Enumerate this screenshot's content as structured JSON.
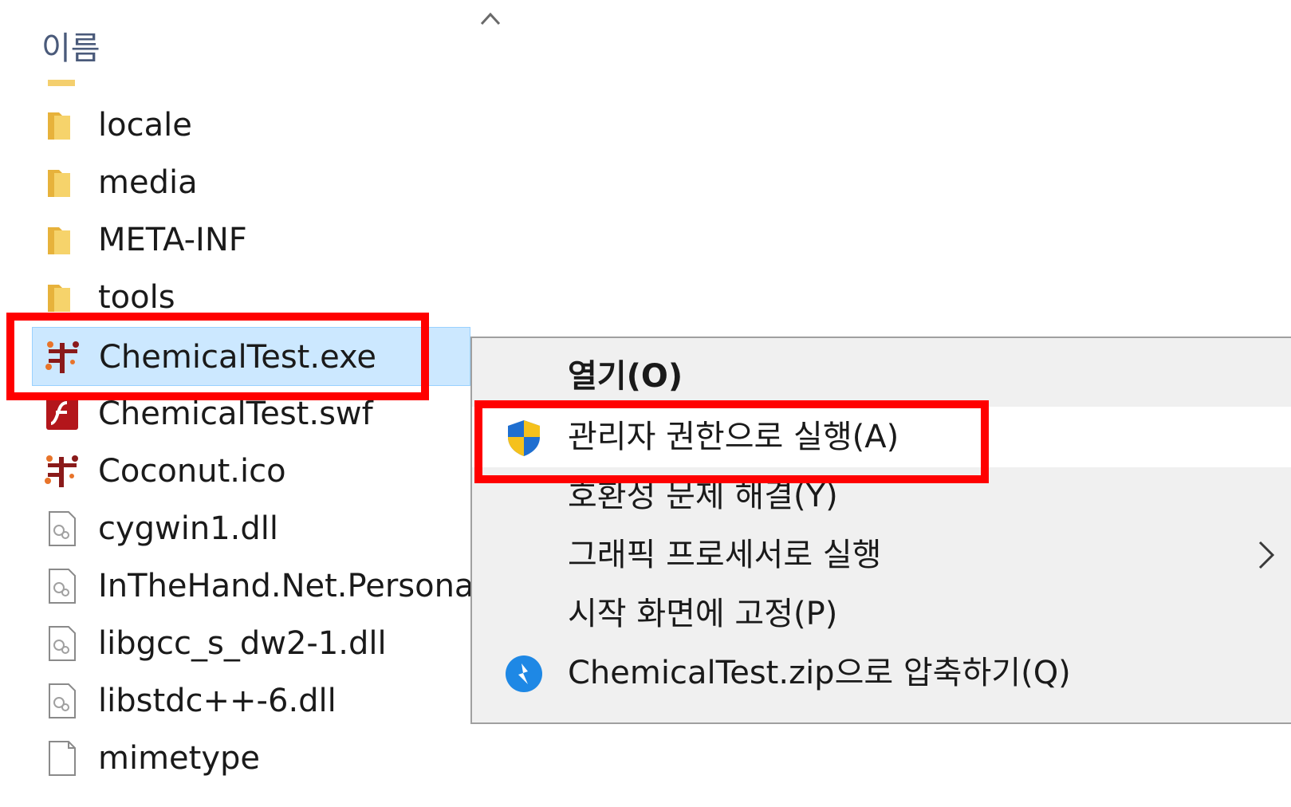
{
  "header": {
    "name_column": "이름"
  },
  "files": [
    {
      "name": "locale",
      "icon": "folder-icon"
    },
    {
      "name": "media",
      "icon": "folder-icon"
    },
    {
      "name": "META-INF",
      "icon": "folder-icon"
    },
    {
      "name": "tools",
      "icon": "folder-icon"
    },
    {
      "name": "ChemicalTest.exe",
      "icon": "exe-app-icon",
      "selected": true
    },
    {
      "name": "ChemicalTest.swf",
      "icon": "flash-file-icon"
    },
    {
      "name": "Coconut.ico",
      "icon": "ico-file-icon"
    },
    {
      "name": "cygwin1.dll",
      "icon": "dll-file-icon"
    },
    {
      "name": "InTheHand.Net.Personal.",
      "icon": "dll-file-icon"
    },
    {
      "name": "libgcc_s_dw2-1.dll",
      "icon": "dll-file-icon"
    },
    {
      "name": "libstdc++-6.dll",
      "icon": "dll-file-icon"
    },
    {
      "name": "mimetype",
      "icon": "blank-file-icon"
    }
  ],
  "context_menu": {
    "items": [
      {
        "label": "열기(O)",
        "icon": ""
      },
      {
        "label": "관리자 권한으로 실행(A)",
        "icon": "uac-shield-icon"
      },
      {
        "label": "호환성 문제 해결(Y)",
        "icon": ""
      },
      {
        "label": "그래픽 프로세서로 실행",
        "icon": "",
        "submenu": true
      },
      {
        "label": "시작 화면에 고정(P)",
        "icon": ""
      },
      {
        "label": "ChemicalTest.zip으로 압축하기(Q)",
        "icon": "bandizip-icon"
      }
    ]
  },
  "colors": {
    "highlight_border": "#ff0000",
    "selection_bg": "#cce8ff",
    "menu_bg": "#f0f0f0",
    "folder": "#f4c542"
  }
}
